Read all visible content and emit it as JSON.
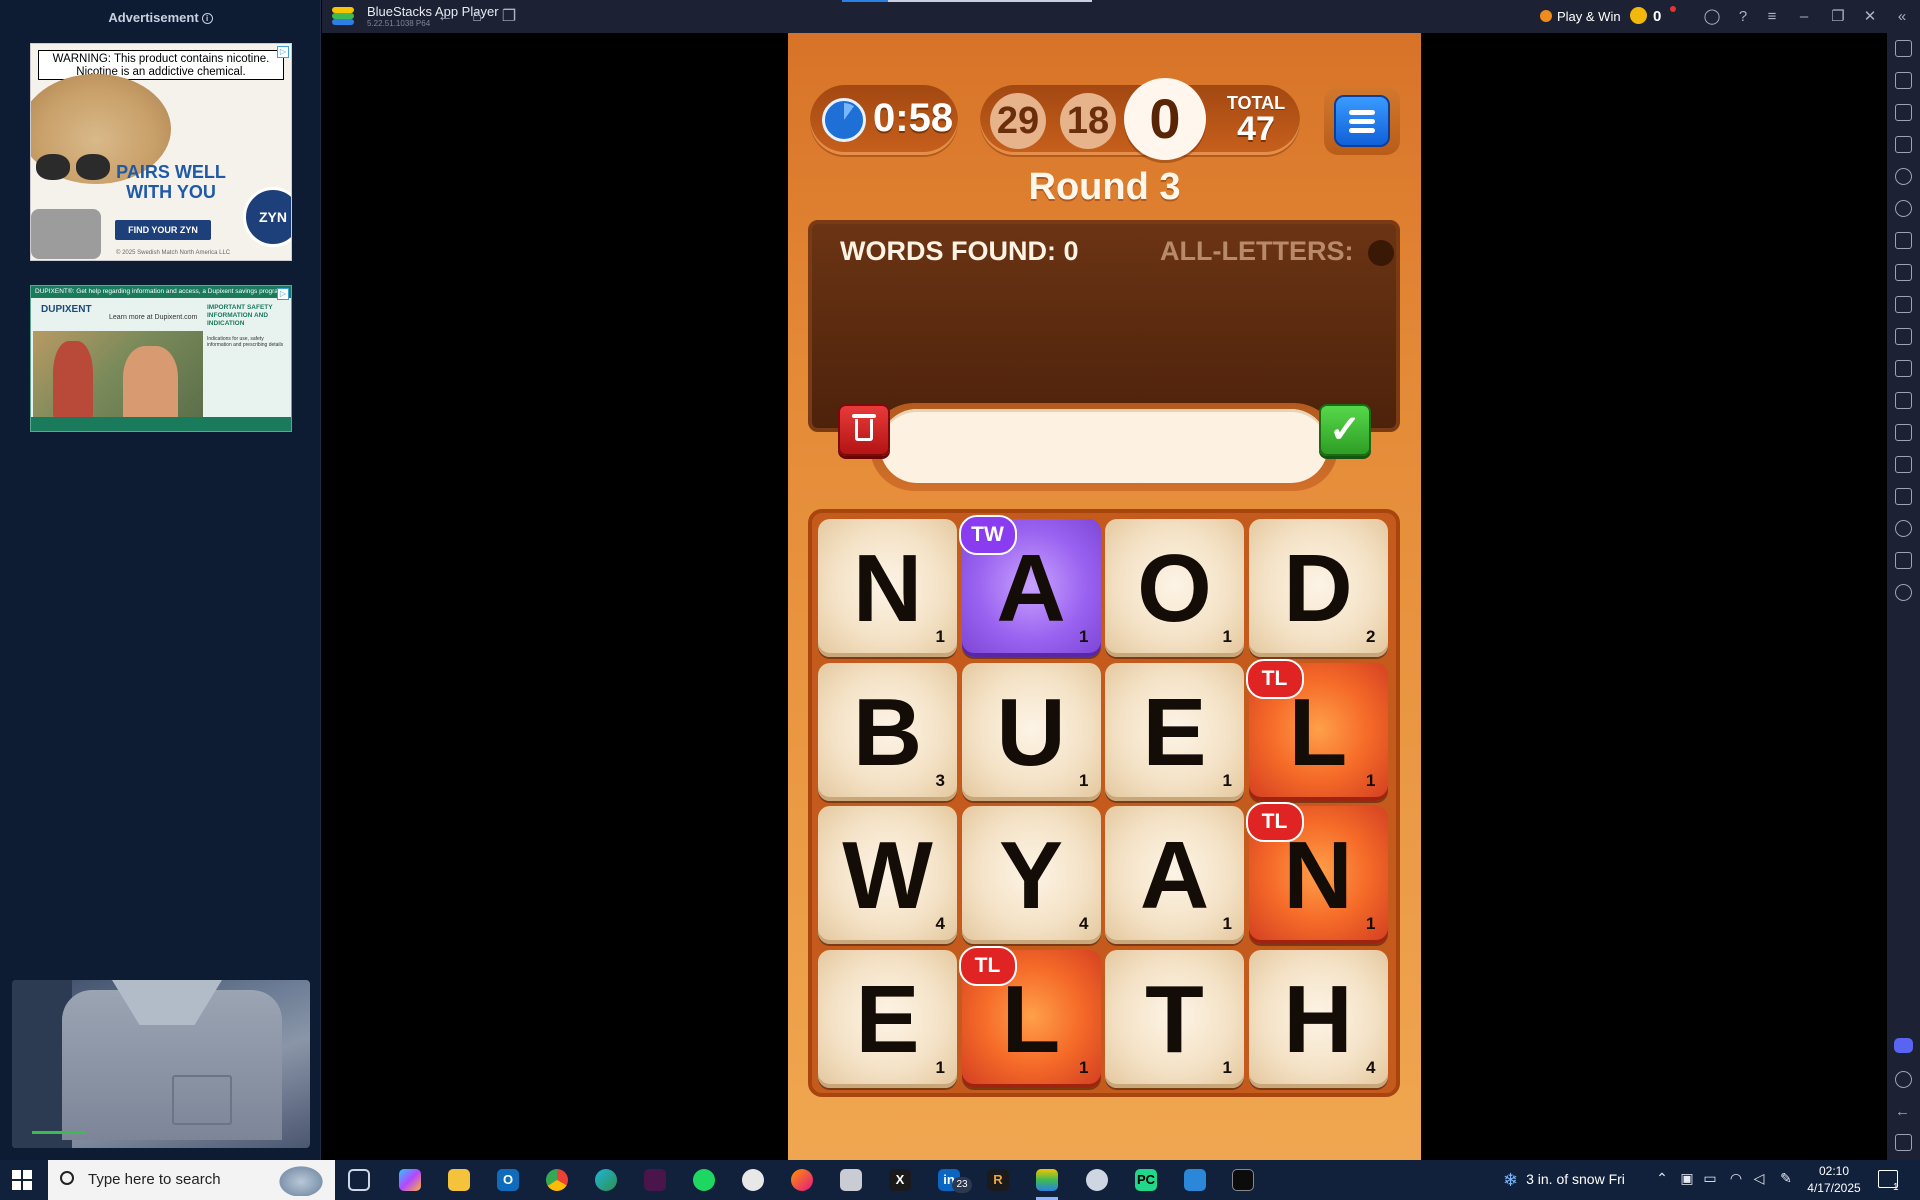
{
  "sidebar": {
    "ad_header": "Advertisement",
    "ad1": {
      "warning": "WARNING: This product contains nicotine. Nicotine is an addictive chemical.",
      "headline": "PAIRS WELL WITH YOU",
      "cta": "FIND YOUR ZYN",
      "brand": "ZYN",
      "fine_print": "© 2025 Swedish Match North America LLC"
    },
    "ad2": {
      "topbar": "DUPIXENT®: Get help regarding information and access, a Dupixent savings program",
      "brand": "DUPIXENT",
      "learn_more": "Learn more at Dupixent.com",
      "side_title": "IMPORTANT SAFETY INFORMATION AND INDICATION",
      "side_text": "Indications for use, safety information and prescribing details"
    }
  },
  "titlebar": {
    "app_title": "BlueStacks App Player",
    "version": "5.22.51.1038  P64",
    "play_win": "Play & Win",
    "coins": "0"
  },
  "game": {
    "timer": "0:58",
    "scores": [
      "29",
      "18"
    ],
    "current_score": "0",
    "total_label": "TOTAL",
    "total_value": "47",
    "round": "Round 3",
    "words_found": "WORDS FOUND: 0",
    "all_letters": "ALL-LETTERS:",
    "accent_colors": {
      "tw": "#8a3cf0",
      "tl": "#e02424",
      "check": "#3fbf35",
      "trash": "#d02222"
    },
    "tiles": [
      {
        "letter": "N",
        "points": "1",
        "bonus": ""
      },
      {
        "letter": "A",
        "points": "1",
        "bonus": "TW"
      },
      {
        "letter": "O",
        "points": "1",
        "bonus": ""
      },
      {
        "letter": "D",
        "points": "2",
        "bonus": ""
      },
      {
        "letter": "B",
        "points": "3",
        "bonus": ""
      },
      {
        "letter": "U",
        "points": "1",
        "bonus": ""
      },
      {
        "letter": "E",
        "points": "1",
        "bonus": ""
      },
      {
        "letter": "L",
        "points": "1",
        "bonus": "TL"
      },
      {
        "letter": "W",
        "points": "4",
        "bonus": ""
      },
      {
        "letter": "Y",
        "points": "4",
        "bonus": ""
      },
      {
        "letter": "A",
        "points": "1",
        "bonus": ""
      },
      {
        "letter": "N",
        "points": "1",
        "bonus": "TL"
      },
      {
        "letter": "E",
        "points": "1",
        "bonus": ""
      },
      {
        "letter": "L",
        "points": "1",
        "bonus": "TL"
      },
      {
        "letter": "T",
        "points": "1",
        "bonus": ""
      },
      {
        "letter": "H",
        "points": "4",
        "bonus": ""
      }
    ]
  },
  "taskbar": {
    "search_placeholder": "Type here to search",
    "linkedin_badge": "23",
    "weather": "3 in. of snow Fri",
    "time": "02:10",
    "date": "4/17/2025",
    "notifications": "1"
  }
}
